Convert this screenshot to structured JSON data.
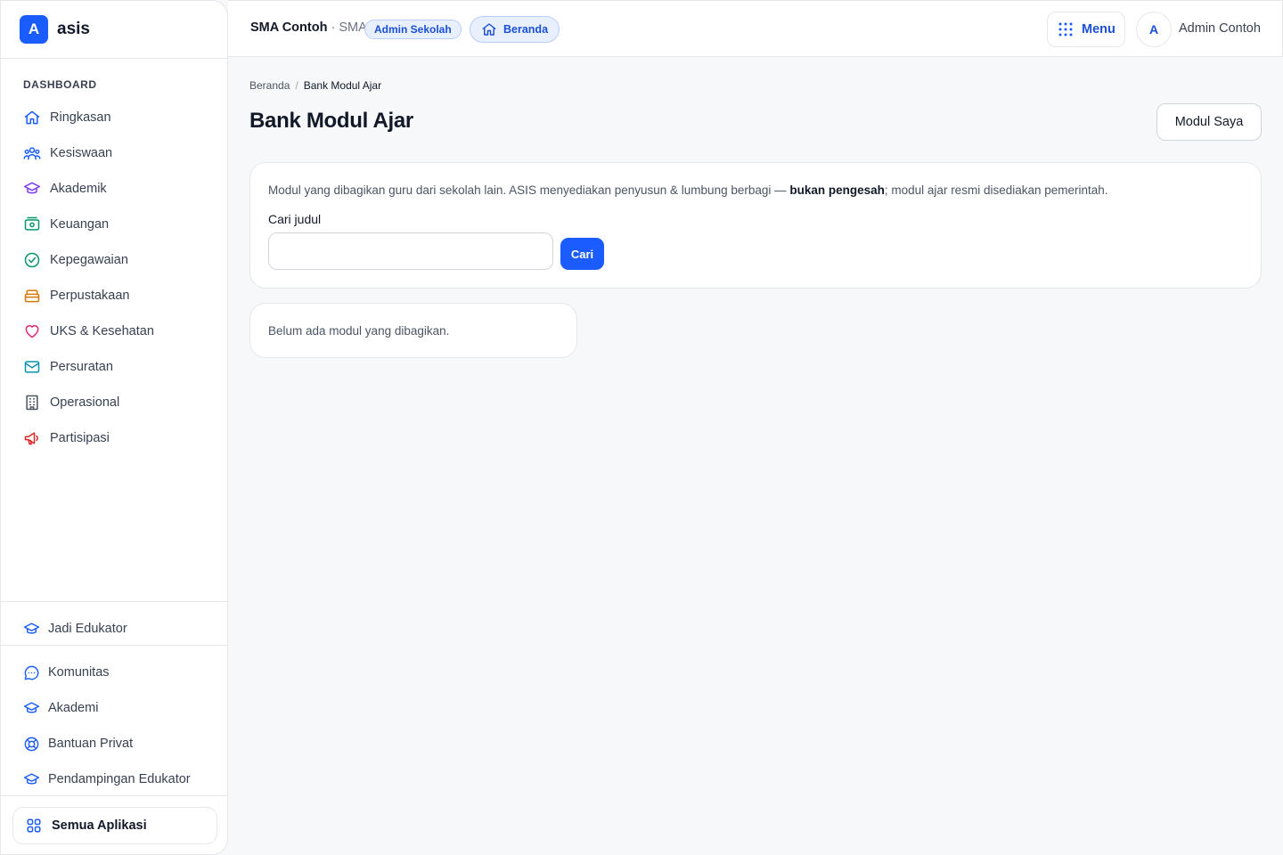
{
  "brand": {
    "logo_letter": "A",
    "name": "asis"
  },
  "sidebar": {
    "section_label": "DASHBOARD",
    "items": [
      {
        "label": "Ringkasan",
        "icon": "home-icon",
        "color": "#1a5cff"
      },
      {
        "label": "Kesiswaan",
        "icon": "users-icon",
        "color": "#1a5cff"
      },
      {
        "label": "Akademik",
        "icon": "graduation-cap-icon",
        "color": "#7c3aed"
      },
      {
        "label": "Keuangan",
        "icon": "money-icon",
        "color": "#059669"
      },
      {
        "label": "Kepegawaian",
        "icon": "badge-check-icon",
        "color": "#059669"
      },
      {
        "label": "Perpustakaan",
        "icon": "archive-icon",
        "color": "#d97706"
      },
      {
        "label": "UKS & Kesehatan",
        "icon": "heart-icon",
        "color": "#db2777"
      },
      {
        "label": "Persuratan",
        "icon": "mail-icon",
        "color": "#0891b2"
      },
      {
        "label": "Operasional",
        "icon": "building-icon",
        "color": "#4b5563"
      },
      {
        "label": "Partisipasi",
        "icon": "megaphone-icon",
        "color": "#dc2626"
      }
    ],
    "become_educator": "Jadi Edukator",
    "links": [
      {
        "label": "Komunitas",
        "icon": "chat-icon"
      },
      {
        "label": "Akademi",
        "icon": "graduation-cap-icon"
      },
      {
        "label": "Bantuan Privat",
        "icon": "lifebuoy-icon"
      },
      {
        "label": "Pendampingan Edukator",
        "icon": "graduation-cap-icon"
      }
    ],
    "all_apps": "Semua Aplikasi"
  },
  "topbar": {
    "school_name": "SMA Contoh",
    "school_type": " · SMA",
    "role_badge": "Admin Sekolah",
    "home_label": "Beranda",
    "menu_label": "Menu",
    "avatar_letter": "A",
    "user_name": "Admin Contoh"
  },
  "breadcrumb": {
    "home": "Beranda",
    "separator": "/",
    "current": "Bank Modul Ajar"
  },
  "page": {
    "title": "Bank Modul Ajar",
    "my_modules_button": "Modul Saya",
    "info_prefix": "Modul yang dibagikan guru dari sekolah lain. ASIS menyediakan penyusun & lumbung berbagi — ",
    "info_bold": "bukan pengesah",
    "info_suffix": "; modul ajar resmi disediakan pemerintah.",
    "search_label": "Cari judul",
    "search_value": "",
    "search_button": "Cari",
    "empty_message": "Belum ada modul yang dibagikan."
  },
  "colors": {
    "accent": "#1a5cff",
    "accent_soft": "#e8efff"
  }
}
